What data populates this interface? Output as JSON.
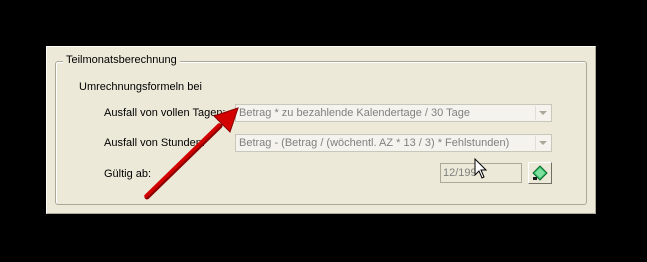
{
  "group": {
    "title": "Teilmonatsberechnung",
    "subtitle": "Umrechnungsformeln bei"
  },
  "rows": {
    "full_days": {
      "label": "Ausfall von vollen Tagen:",
      "value": "Betrag * zu bezahlende Kalendertage / 30 Tage"
    },
    "hours": {
      "label": "Ausfall von Stunden:",
      "value": "Betrag - (Betrag / (wöchentl. AZ * 13 / 3) * Fehlstunden)"
    },
    "valid_from": {
      "label": "Gültig ab:",
      "value": "12/199"
    }
  },
  "icons": {
    "dropdown": "chevron-down-icon",
    "calendar": "calendar-picker-icon",
    "annotation": "red-arrow",
    "pointer": "mouse-cursor-icon"
  },
  "colors": {
    "window": "#ece9d8",
    "disabled_text": "#808080",
    "annotation": "#d40000"
  }
}
